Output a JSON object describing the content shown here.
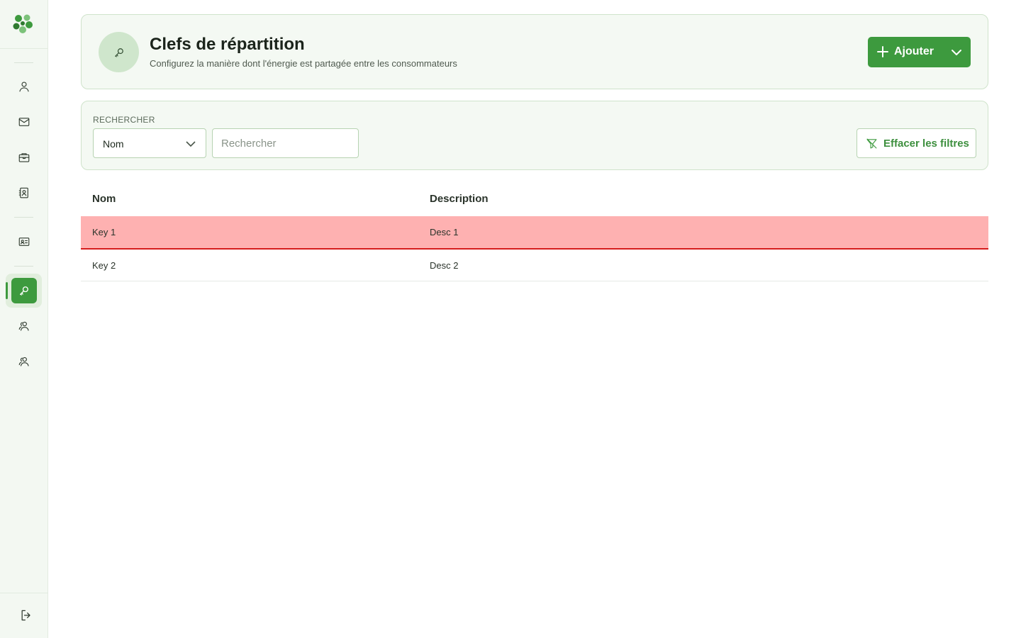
{
  "sidebar": {
    "items": [
      {
        "name": "user-icon"
      },
      {
        "name": "mail-icon"
      },
      {
        "name": "briefcase-icon"
      },
      {
        "name": "contact-book-icon"
      },
      {
        "name": "id-card-icon"
      },
      {
        "name": "key-icon",
        "active": true
      },
      {
        "name": "users-icon"
      },
      {
        "name": "users-icon"
      }
    ],
    "logout_icon": "logout-icon"
  },
  "header": {
    "title": "Clefs de répartition",
    "subtitle": "Configurez la manière dont l'énergie est partagée entre les consommateurs",
    "add_label": "Ajouter"
  },
  "filters": {
    "label": "RECHERCHER",
    "field_selected": "Nom",
    "search_placeholder": "Rechercher",
    "clear_label": "Effacer les filtres"
  },
  "table": {
    "columns": [
      "Nom",
      "Description"
    ],
    "rows": [
      {
        "name": "Key 1",
        "description": "Desc 1",
        "selected": true
      },
      {
        "name": "Key 2",
        "description": "Desc 2",
        "selected": false
      }
    ]
  },
  "colors": {
    "accent": "#3d9a3e",
    "selected_row": "#feb1b1",
    "selected_border": "#d51c1c"
  }
}
